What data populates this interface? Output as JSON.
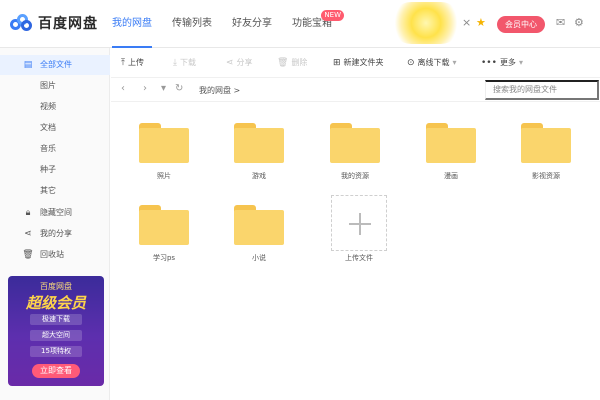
{
  "header": {
    "logo_text": "百度网盘",
    "tabs": [
      {
        "label": "我的网盘",
        "active": true
      },
      {
        "label": "传输列表",
        "active": false
      },
      {
        "label": "好友分享",
        "active": false
      },
      {
        "label": "功能宝箱",
        "active": false,
        "badge": "NEW"
      }
    ],
    "vip_label": "会员中心",
    "close_glyph": "×",
    "icons": [
      "star-icon",
      "mail-icon",
      "settings-icon"
    ]
  },
  "sidebar": {
    "items": [
      {
        "label": "全部文件",
        "icon": "file-icon",
        "active": true
      },
      {
        "label": "图片"
      },
      {
        "label": "视频"
      },
      {
        "label": "文档"
      },
      {
        "label": "音乐"
      },
      {
        "label": "种子"
      },
      {
        "label": "其它"
      },
      {
        "label": "隐藏空间",
        "icon": "lock-icon"
      },
      {
        "label": "我的分享",
        "icon": "share-icon"
      },
      {
        "label": "回收站",
        "icon": "trash-icon"
      }
    ],
    "promo": {
      "line1": "百度网盘",
      "line2": "超级会员",
      "features": [
        "极速下载",
        "超大空间",
        "15项特权"
      ],
      "button": "立即查看"
    }
  },
  "toolbar": {
    "upload": "上传",
    "download": "下载",
    "share": "分享",
    "delete": "删除",
    "new_folder": "新建文件夹",
    "offline": "离线下载",
    "more": "更多"
  },
  "pathbar": {
    "crumb": "我的网盘 >",
    "search_placeholder": "搜索我的网盘文件"
  },
  "files": [
    {
      "name": "照片"
    },
    {
      "name": "游戏"
    },
    {
      "name": "我的资源"
    },
    {
      "name": "漫画"
    },
    {
      "name": "影视资源"
    },
    {
      "name": "学习ps"
    },
    {
      "name": "小说"
    }
  ],
  "uploader": {
    "label": "上传文件"
  },
  "colors": {
    "accent": "#3a7cf5",
    "folder": "#fad56c",
    "vip": "#f2576c"
  }
}
